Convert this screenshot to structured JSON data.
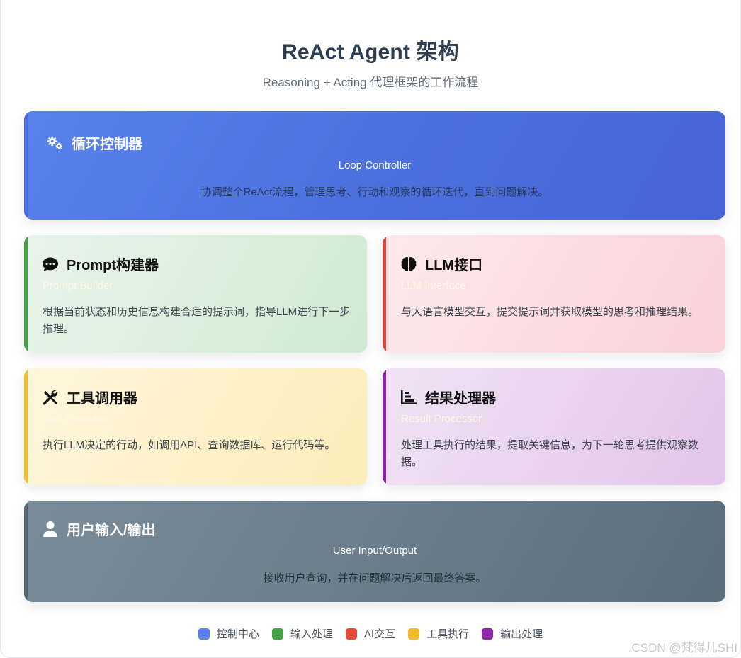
{
  "title": "ReAct Agent 架构",
  "subtitle": "Reasoning + Acting 代理框架的工作流程",
  "loop": {
    "name": "循环控制器",
    "en": "Loop Controller",
    "desc": "协调整个ReAct流程，管理思考、行动和观察的循环迭代，直到问题解决。",
    "icon": "gears-icon"
  },
  "prompt": {
    "name": "Prompt构建器",
    "en": "Prompt Builder",
    "desc": "根据当前状态和历史信息构建合适的提示词，指导LLM进行下一步推理。",
    "icon": "comment-icon"
  },
  "llm": {
    "name": "LLM接口",
    "en": "LLM Interface",
    "desc": "与大语言模型交互，提交提示词并获取模型的思考和推理结果。",
    "icon": "brain-icon"
  },
  "tool": {
    "name": "工具调用器",
    "en": "Tool Executor",
    "desc": "执行LLM决定的行动，如调用API、查询数据库、运行代码等。",
    "icon": "tools-icon"
  },
  "result": {
    "name": "结果处理器",
    "en": "Result Processor",
    "desc": "处理工具执行的结果，提取关键信息，为下一轮思考提供观察数据。",
    "icon": "chart-icon"
  },
  "user": {
    "name": "用户输入/输出",
    "en": "User Input/Output",
    "desc": "接收用户查询，并在问题解决后返回最终答案。",
    "icon": "user-icon"
  },
  "legend": [
    {
      "label": "控制中心",
      "color": "#5b80ec"
    },
    {
      "label": "输入处理",
      "color": "#43a047"
    },
    {
      "label": "AI交互",
      "color": "#e04b3a"
    },
    {
      "label": "工具执行",
      "color": "#f3bb25"
    },
    {
      "label": "输出处理",
      "color": "#9127a8"
    }
  ],
  "watermark": "CSDN @梵得儿SHI"
}
